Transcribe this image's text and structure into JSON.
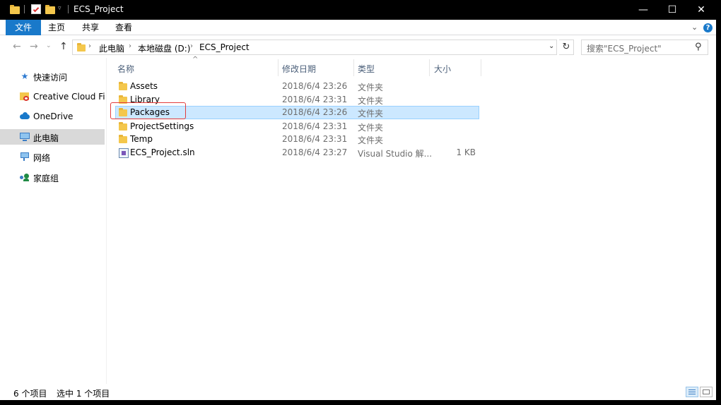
{
  "window": {
    "title": "ECS_Project"
  },
  "titlebar_buttons": {
    "minimize": "—",
    "maximize": "☐",
    "close": "✕"
  },
  "ribbon": {
    "tabs": [
      "文件",
      "主页",
      "共享",
      "查看"
    ]
  },
  "address": {
    "crumbs": [
      "此电脑",
      "本地磁盘 (D:)",
      "ECS_Project"
    ]
  },
  "search": {
    "placeholder": "搜索\"ECS_Project\""
  },
  "navpane": {
    "items": [
      {
        "label": "快速访问",
        "icon": "star-icon"
      },
      {
        "label": "Creative Cloud Files",
        "icon": "creative-cloud-icon"
      },
      {
        "label": "OneDrive",
        "icon": "cloud-icon"
      },
      {
        "label": "此电脑",
        "icon": "computer-icon",
        "selected": true
      },
      {
        "label": "网络",
        "icon": "network-icon"
      },
      {
        "label": "家庭组",
        "icon": "homegroup-icon"
      }
    ]
  },
  "columns": {
    "name": "名称",
    "date": "修改日期",
    "type": "类型",
    "size": "大小"
  },
  "files": [
    {
      "name": "Assets",
      "date": "2018/6/4 23:26",
      "type": "文件夹",
      "size": "",
      "icon": "folder-icon"
    },
    {
      "name": "Library",
      "date": "2018/6/4 23:31",
      "type": "文件夹",
      "size": "",
      "icon": "folder-icon"
    },
    {
      "name": "Packages",
      "date": "2018/6/4 23:26",
      "type": "文件夹",
      "size": "",
      "icon": "folder-icon",
      "selected": true
    },
    {
      "name": "ProjectSettings",
      "date": "2018/6/4 23:31",
      "type": "文件夹",
      "size": "",
      "icon": "folder-icon"
    },
    {
      "name": "Temp",
      "date": "2018/6/4 23:31",
      "type": "文件夹",
      "size": "",
      "icon": "folder-icon"
    },
    {
      "name": "ECS_Project.sln",
      "date": "2018/6/4 23:27",
      "type": "Visual Studio 解...",
      "size": "1 KB",
      "icon": "visual-studio-solution-icon"
    }
  ],
  "status": {
    "item_count": "6 个项目",
    "selection": "选中 1 个项目"
  },
  "colors": {
    "accent": "#1979ca",
    "selection": "#cce8ff",
    "folder": "#f4c74c",
    "highlight_box": "#e23b3b"
  }
}
